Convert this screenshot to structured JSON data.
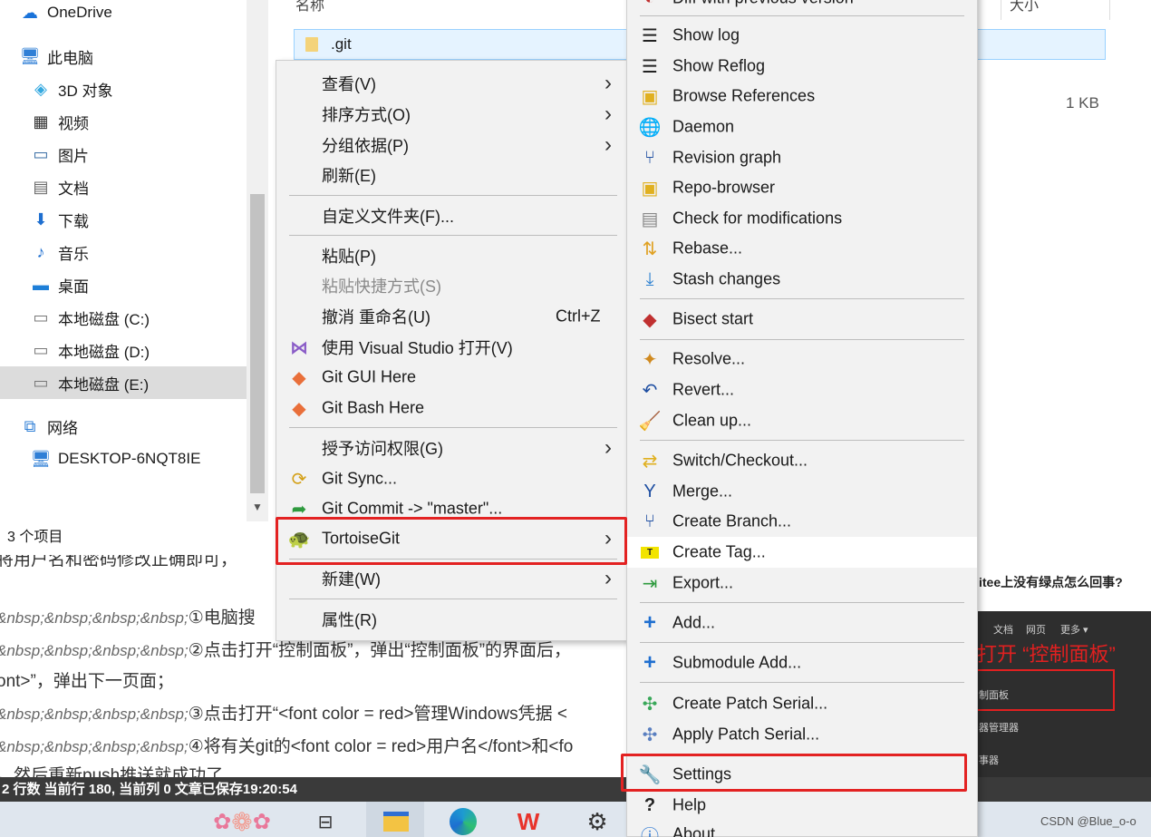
{
  "explorer": {
    "nav": [
      {
        "label": "OneDrive",
        "icon": "cloud-icon"
      },
      {
        "label": "此电脑",
        "icon": "computer-icon"
      },
      {
        "label": "3D 对象",
        "icon": "cube-icon"
      },
      {
        "label": "视频",
        "icon": "video-icon"
      },
      {
        "label": "图片",
        "icon": "picture-icon"
      },
      {
        "label": "文档",
        "icon": "document-icon"
      },
      {
        "label": "下载",
        "icon": "download-icon"
      },
      {
        "label": "音乐",
        "icon": "music-icon"
      },
      {
        "label": "桌面",
        "icon": "desktop-icon"
      },
      {
        "label": "本地磁盘 (C:)",
        "icon": "drive-icon"
      },
      {
        "label": "本地磁盘 (D:)",
        "icon": "drive-icon"
      },
      {
        "label": "本地磁盘 (E:)",
        "icon": "drive-icon"
      },
      {
        "label": "网络",
        "icon": "network-icon"
      },
      {
        "label": "DESKTOP-6NQT8IE",
        "icon": "network-computer-icon"
      }
    ],
    "status": "3 个项目",
    "col_name": "名称",
    "col_size": "大小",
    "file_name": ".git",
    "file_size": "1 KB"
  },
  "context_menu": {
    "items": [
      {
        "label": "查看(V)",
        "submenu": true
      },
      {
        "label": "排序方式(O)",
        "submenu": true
      },
      {
        "label": "分组依据(P)",
        "submenu": true
      },
      {
        "label": "刷新(E)"
      },
      {
        "label": "自定义文件夹(F)..."
      },
      {
        "label": "粘贴(P)"
      },
      {
        "label": "粘贴快捷方式(S)",
        "disabled": true
      },
      {
        "label": "撤消 重命名(U)",
        "shortcut": "Ctrl+Z"
      },
      {
        "label": "使用 Visual Studio 打开(V)",
        "icon": "visual-studio-icon"
      },
      {
        "label": "Git GUI Here",
        "icon": "git-icon"
      },
      {
        "label": "Git Bash Here",
        "icon": "git-icon"
      },
      {
        "label": "授予访问权限(G)",
        "submenu": true
      },
      {
        "label": "Git Sync...",
        "icon": "git-sync-icon"
      },
      {
        "label": "Git Commit -> \"master\"...",
        "icon": "git-commit-icon"
      },
      {
        "label": "TortoiseGit",
        "icon": "tortoisegit-icon",
        "submenu": true
      },
      {
        "label": "新建(W)",
        "submenu": true
      },
      {
        "label": "属性(R)"
      }
    ]
  },
  "tortoisegit_menu": {
    "items": [
      {
        "label": "Diff with previous version",
        "icon": "diff-icon"
      },
      {
        "label": "Show log",
        "icon": "log-icon"
      },
      {
        "label": "Show Reflog",
        "icon": "log-icon"
      },
      {
        "label": "Browse References",
        "icon": "references-icon"
      },
      {
        "label": "Daemon",
        "icon": "globe-icon"
      },
      {
        "label": "Revision graph",
        "icon": "revision-graph-icon"
      },
      {
        "label": "Repo-browser",
        "icon": "repo-browser-icon"
      },
      {
        "label": "Check for modifications",
        "icon": "check-modifications-icon"
      },
      {
        "label": "Rebase...",
        "icon": "rebase-icon"
      },
      {
        "label": "Stash changes",
        "icon": "stash-icon"
      },
      {
        "label": "Bisect start",
        "icon": "bisect-icon"
      },
      {
        "label": "Resolve...",
        "icon": "resolve-icon"
      },
      {
        "label": "Revert...",
        "icon": "revert-icon"
      },
      {
        "label": "Clean up...",
        "icon": "broom-icon"
      },
      {
        "label": "Switch/Checkout...",
        "icon": "switch-icon"
      },
      {
        "label": "Merge...",
        "icon": "merge-icon"
      },
      {
        "label": "Create Branch...",
        "icon": "branch-icon"
      },
      {
        "label": "Create Tag...",
        "icon": "tag-icon"
      },
      {
        "label": "Export...",
        "icon": "export-icon"
      },
      {
        "label": "Add...",
        "icon": "plus-icon"
      },
      {
        "label": "Submodule Add...",
        "icon": "plus-icon"
      },
      {
        "label": "Create Patch Serial...",
        "icon": "patch-icon"
      },
      {
        "label": "Apply Patch Serial...",
        "icon": "patch-icon"
      },
      {
        "label": "Settings",
        "icon": "wrench-icon"
      },
      {
        "label": "Help",
        "icon": "help-icon"
      },
      {
        "label": "About",
        "icon": "info-icon"
      }
    ]
  },
  "editor": {
    "lines": [
      {
        "prefix": "",
        "text": "将用户名和密码修改正确即可，"
      },
      {
        "prefix": "&nbsp;&nbsp;&nbsp;&nbsp;",
        "text": "①电脑搜"
      },
      {
        "prefix": "&nbsp;&nbsp;&nbsp;&nbsp;",
        "text": "②点击打开“控制面板”，弹出“控制面板”的界面后，"
      },
      {
        "prefix": "",
        "text": "ont>”，弹出下一页面；"
      },
      {
        "prefix": "&nbsp;&nbsp;&nbsp;&nbsp;",
        "text": "③点击打开“<font color = red>管理Windows凭据 <"
      },
      {
        "prefix": "&nbsp;&nbsp;&nbsp;&nbsp;",
        "text": "④将有关git的<font color = red>用户名</font>和<fo"
      },
      {
        "prefix": "",
        "text": "，然后重新push推送就成功了"
      }
    ],
    "status": "2 行数  当前行 180, 当前列 0  文章已保存19:20:54",
    "right_heading": "itee上没有绿点怎么回事?",
    "panel_menu": [
      "文档",
      "网页",
      "更多 ▾"
    ],
    "panel_title": "打开 “控制面板”",
    "panel_items": [
      "制面板",
      "器管理器",
      "事器"
    ]
  },
  "taskbar": {
    "icons": [
      "brain-sticker-icon",
      "task-view-icon",
      "file-explorer-icon",
      "edge-icon",
      "wps-icon",
      "settings-icon"
    ]
  },
  "watermark": "CSDN @Blue_o-o",
  "colors": {
    "highlight_red": "#e32222",
    "menu_bg": "#f2f2f2",
    "selection_blue": "#e5f3ff"
  }
}
